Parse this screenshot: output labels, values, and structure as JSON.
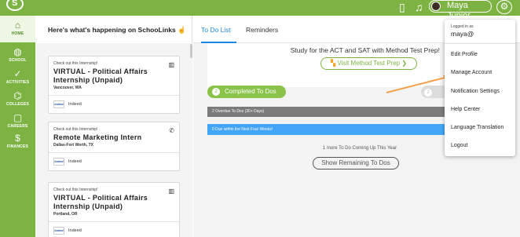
{
  "colors": {
    "brand_green": "#7cb342",
    "tab_blue": "#1e88e5",
    "completed_green": "#8bc34a",
    "overdue_gray": "#7b7b7b",
    "due_blue": "#42a5f5",
    "annotation_orange": "#f5a04a"
  },
  "topbar": {
    "icons": [
      "logo-icon",
      "mobile-icon",
      "bell-icon",
      "envelope-icon",
      "gear-icon"
    ],
    "user_name": "Maya Junior"
  },
  "sidebar": {
    "items": [
      {
        "label": "HOME",
        "icon": "home-icon"
      },
      {
        "label": "SCHOOL",
        "icon": "apple-icon"
      },
      {
        "label": "ACTIVITIES",
        "icon": "check-circle-icon"
      },
      {
        "label": "COLLEGES",
        "icon": "building-icon"
      },
      {
        "label": "CAREERS",
        "icon": "briefcase-icon"
      },
      {
        "label": "FINANCES",
        "icon": "money-bag-icon"
      }
    ]
  },
  "feed": {
    "title": "Here's what's happening on SchooLinks",
    "cards": [
      {
        "kicker": "Check out this Internship!",
        "title": "VIRTUAL - Political Affairs Internship (Unpaid)",
        "location": "Vancouver, WA",
        "source": "Indeed",
        "icon": "building-icon"
      },
      {
        "kicker": "Check out this Internship!",
        "title": "Remote Marketing Intern",
        "location": "Dallas-Fort Worth, TX",
        "source": "Indeed",
        "icon": "phone-icon"
      },
      {
        "kicker": "Check out this Internship!",
        "title": "VIRTUAL - Political Affairs Internship (Unpaid)",
        "location": "Portland, OR",
        "source": "Indeed",
        "icon": "building-icon"
      }
    ]
  },
  "main": {
    "tabs": [
      {
        "label": "To Do List",
        "active": true
      },
      {
        "label": "Reminders",
        "active": false
      }
    ],
    "promo_text": "Study for the ACT and SAT with Method Test Prep!",
    "promo_button": "Visit Method Test Prep",
    "completed_count": "2",
    "completed_label": "Completed To Dos",
    "ghost_count": "2",
    "overdue_label": "2 Overdue To Dos (30+ Days)",
    "due_label": "0 Due within the Next Four Weeks!",
    "more_text": "1 more To Do Coming Up This Year",
    "show_button": "Show Remaining To Dos"
  },
  "dropdown": {
    "logged_in_as": "Logged in as",
    "username": "maya@",
    "items": [
      "Edit Profile",
      "Manage Account",
      "Notification Settings",
      "Help Center",
      "Language Translation",
      "Logout"
    ]
  }
}
